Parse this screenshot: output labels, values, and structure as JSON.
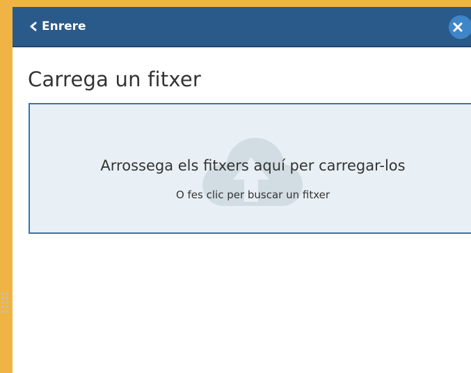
{
  "header": {
    "back_label": "Enrere",
    "back_icon": "chevron-left-icon",
    "close_icon": "close-icon"
  },
  "page": {
    "title": "Carrega un fitxer"
  },
  "dropzone": {
    "main_text": "Arrossega els fitxers aquí per carregar-los",
    "sub_text": "O fes clic per buscar un fitxer",
    "icon": "cloud-upload-icon"
  },
  "colors": {
    "background": "#f0b444",
    "header_bar": "#2a5a8a",
    "close_button": "#3f86c8",
    "dropzone_fill": "#e9f0f5",
    "dropzone_border": "#3573b3",
    "text": "#333333"
  }
}
